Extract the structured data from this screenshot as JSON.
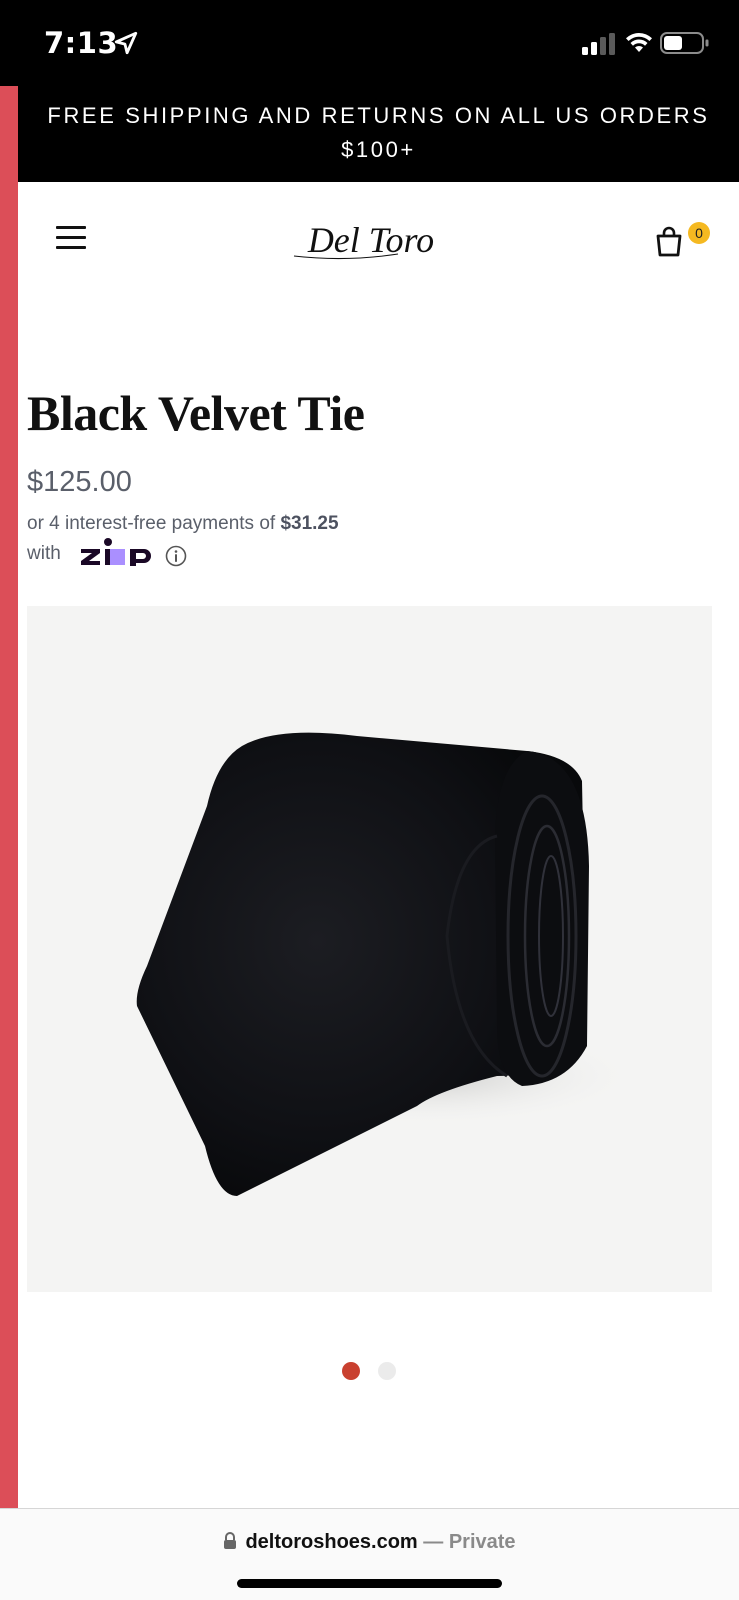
{
  "status_bar": {
    "time": "7:13",
    "icons": [
      "location-arrow-icon",
      "cellular-signal-icon",
      "wifi-icon",
      "battery-icon"
    ]
  },
  "promo": {
    "text": "FREE SHIPPING AND RETURNS ON ALL US ORDERS $100+"
  },
  "header": {
    "brand": "Del Toro",
    "cart_count": "0",
    "icons": [
      "hamburger-menu-icon",
      "shopping-bag-icon"
    ]
  },
  "product": {
    "title": "Black Velvet Tie",
    "price": "$125.00",
    "installment_prefix": "or 4 interest-free payments of ",
    "installment_amount": "$31.25",
    "installment_with": "with",
    "installment_provider": "zip",
    "image_alt": "Black velvet tie rolled"
  },
  "carousel": {
    "total": 2,
    "active_index": 0
  },
  "browser": {
    "domain": "deltoroshoes.com",
    "private_label": " — Private"
  },
  "colors": {
    "accent_strip": "#dc4e58",
    "active_dot": "#c9402f",
    "cart_badge": "#f5b921",
    "zip_purple": "#aa8fff",
    "zip_dark": "#1a0826"
  }
}
